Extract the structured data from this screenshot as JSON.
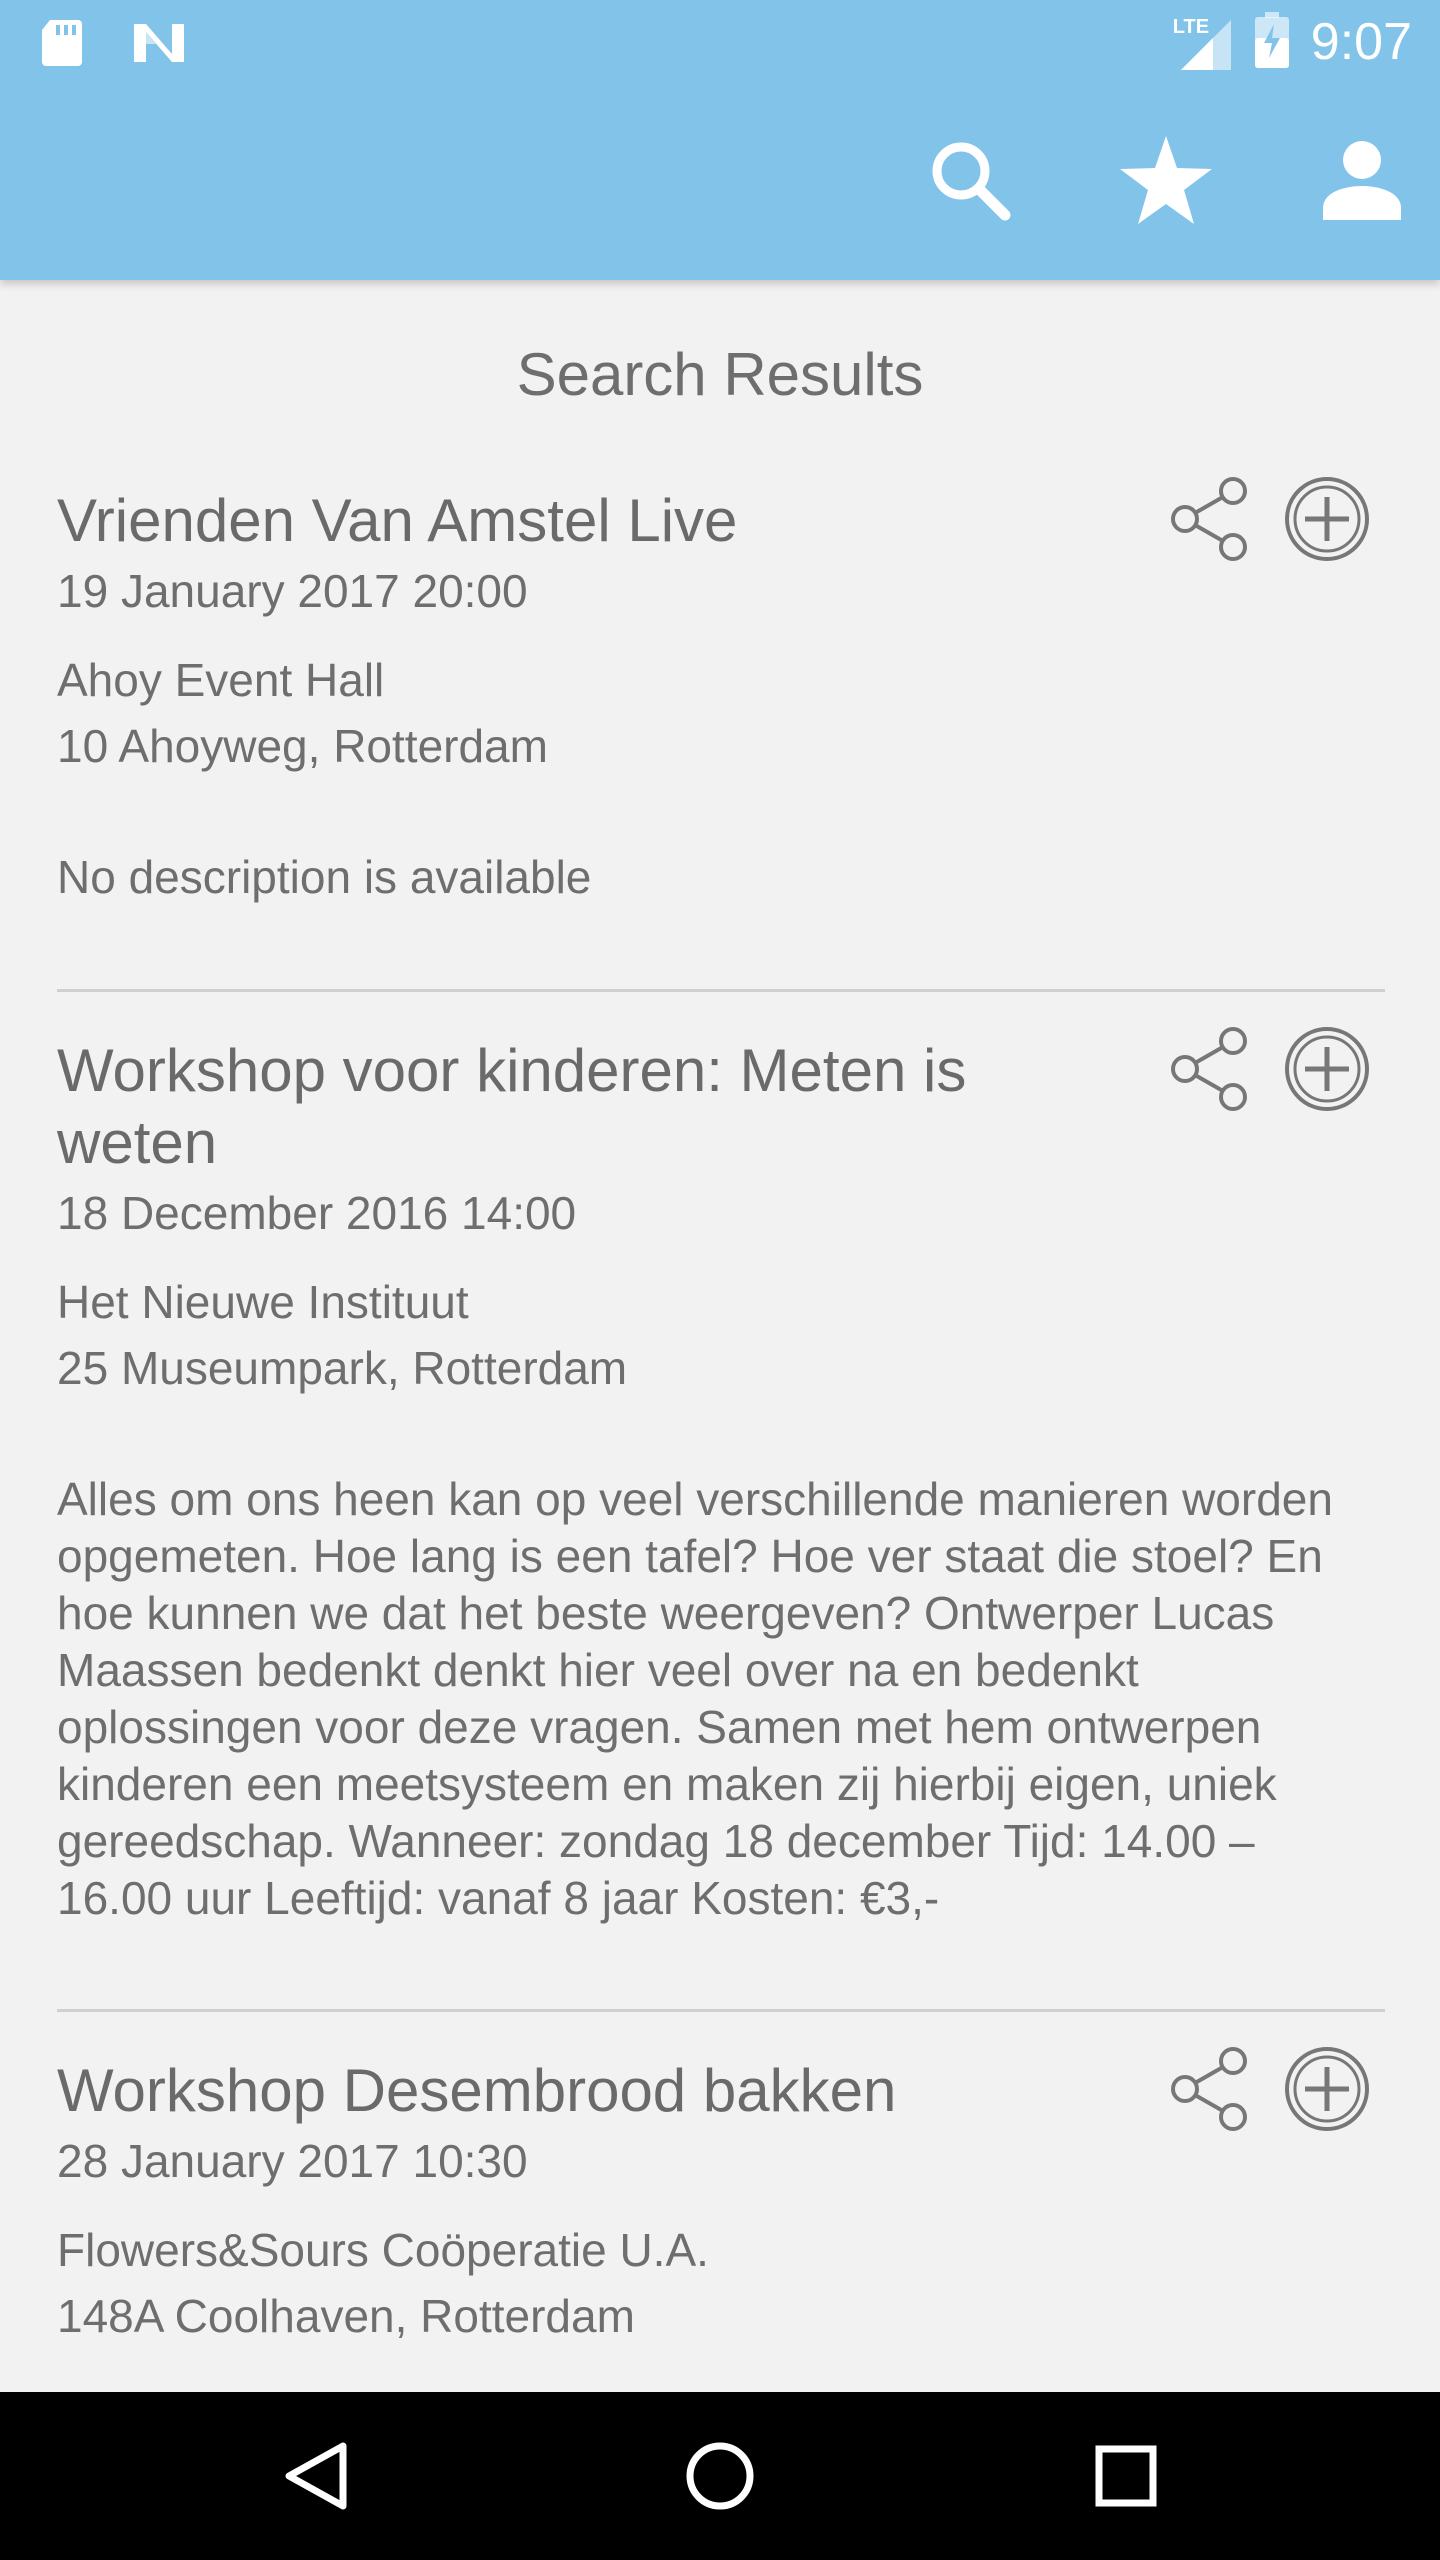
{
  "status_bar": {
    "time": "9:07",
    "network": "LTE",
    "icons": [
      "sd-card-icon",
      "n-logo-icon",
      "signal-icon",
      "battery-charging-icon"
    ]
  },
  "toolbar": {
    "actions": [
      "search-icon",
      "star-icon",
      "person-icon"
    ]
  },
  "page": {
    "title": "Search Results"
  },
  "events": [
    {
      "title": "Vrienden Van Amstel Live",
      "date": "19 January 2017 20:00",
      "venue": "Ahoy Event Hall",
      "address": "10 Ahoyweg, Rotterdam",
      "description": "No description is available"
    },
    {
      "title": "Workshop voor kinderen: Meten is weten",
      "date": "18 December 2016 14:00",
      "venue": "Het Nieuwe Instituut",
      "address": "25 Museumpark, Rotterdam",
      "description": "Alles om ons heen kan op veel verschillende manieren worden opgemeten. Hoe lang is een tafel? Hoe ver staat die stoel? En hoe kunnen we dat het beste weergeven? Ontwerper Lucas Maassen bedenkt denkt hier veel over na en bedenkt oplossingen voor deze vragen. Samen met hem ontwerpen kinderen een meetsysteem en maken zij hierbij eigen, uniek gereedschap. Wanneer: zondag 18 december Tijd: 14.00 – 16.00 uur Leeftijd: vanaf 8 jaar Kosten: €3,-"
    },
    {
      "title": "Workshop Desembrood bakken",
      "date": "28 January 2017 10:30",
      "venue": "Flowers&Sours Coöperatie U.A.",
      "address": "148A Coolhaven, Rotterdam",
      "description": ""
    }
  ],
  "navigation": [
    "back-icon",
    "home-icon",
    "recents-icon"
  ],
  "colors": {
    "app_bar": "#82c3ea",
    "background": "#f2f2f2",
    "text": "#6e6e6e",
    "nav_bar": "#000000"
  }
}
